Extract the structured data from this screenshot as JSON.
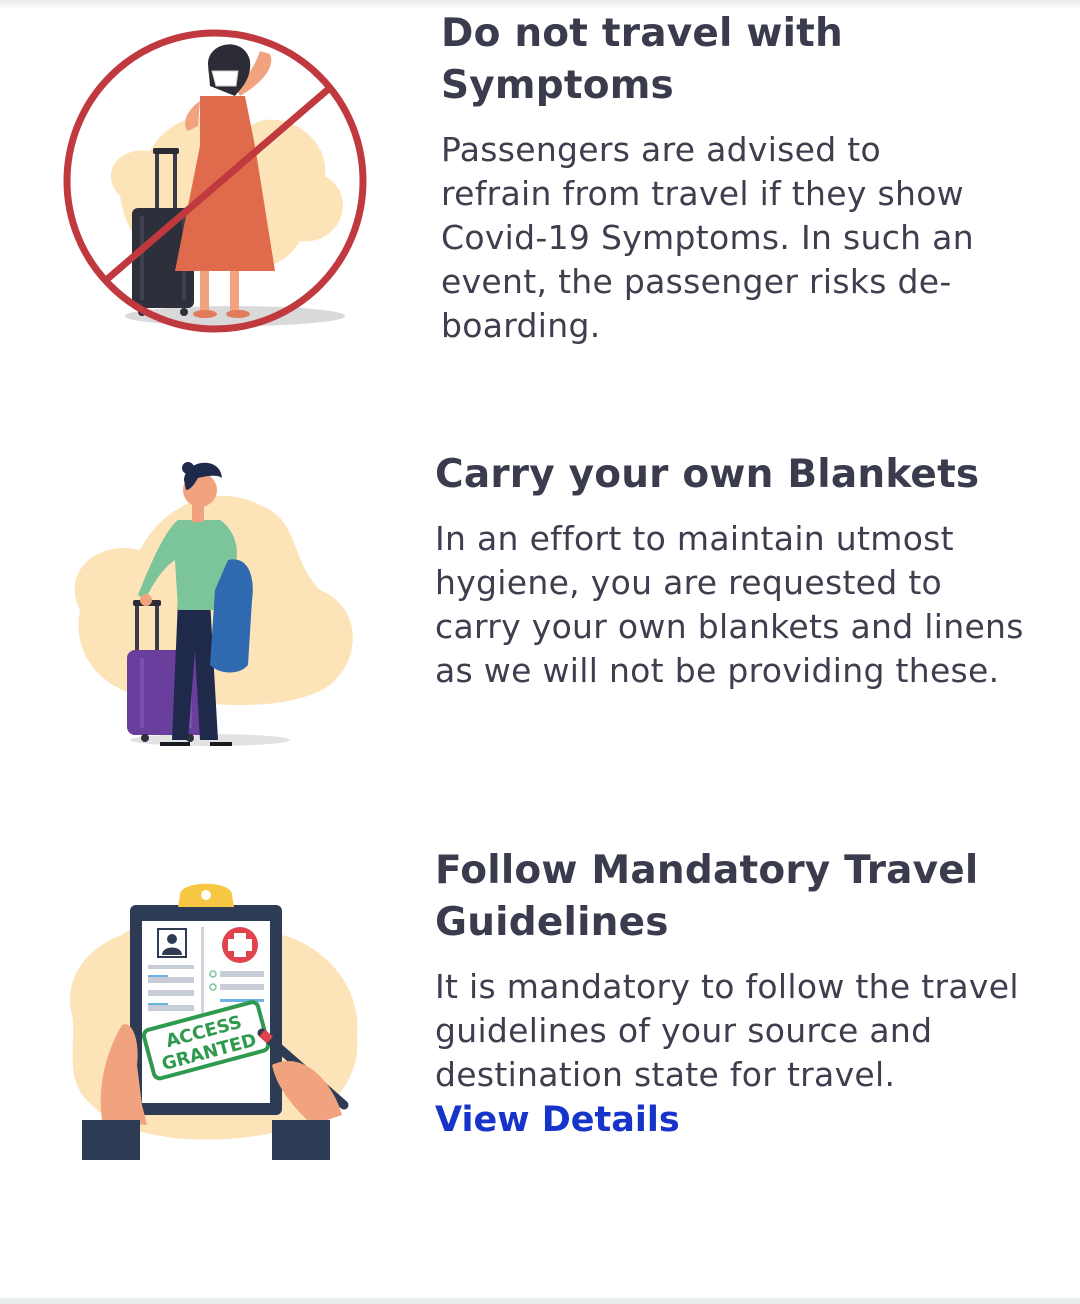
{
  "guidelines": [
    {
      "title": "Do not travel with Symptoms",
      "description": "Passengers are advised to refrain from travel if they show Covid-19 Symptoms. In such an event, the passenger risks de-boarding.",
      "icon": "no-travel-symptoms-illustration"
    },
    {
      "title": "Carry your own Blankets",
      "description": "In an effort to maintain utmost hygiene, you are requested to carry your own blankets and linens as we will not be providing these.",
      "icon": "traveler-with-blanket-illustration"
    },
    {
      "title": "Follow Mandatory Travel Guidelines",
      "description": "It is mandatory to follow the travel guidelines of your source and destination state for travel.",
      "link_label": "View Details",
      "stamp_line1": "ACCESS",
      "stamp_line2": "GRANTED",
      "icon": "clipboard-access-granted-illustration"
    }
  ],
  "colors": {
    "title": "#3a3c4d",
    "body": "#3d3f4f",
    "link": "#1634c9",
    "blob": "#fde3b8",
    "prohibit": "#c0393f"
  }
}
